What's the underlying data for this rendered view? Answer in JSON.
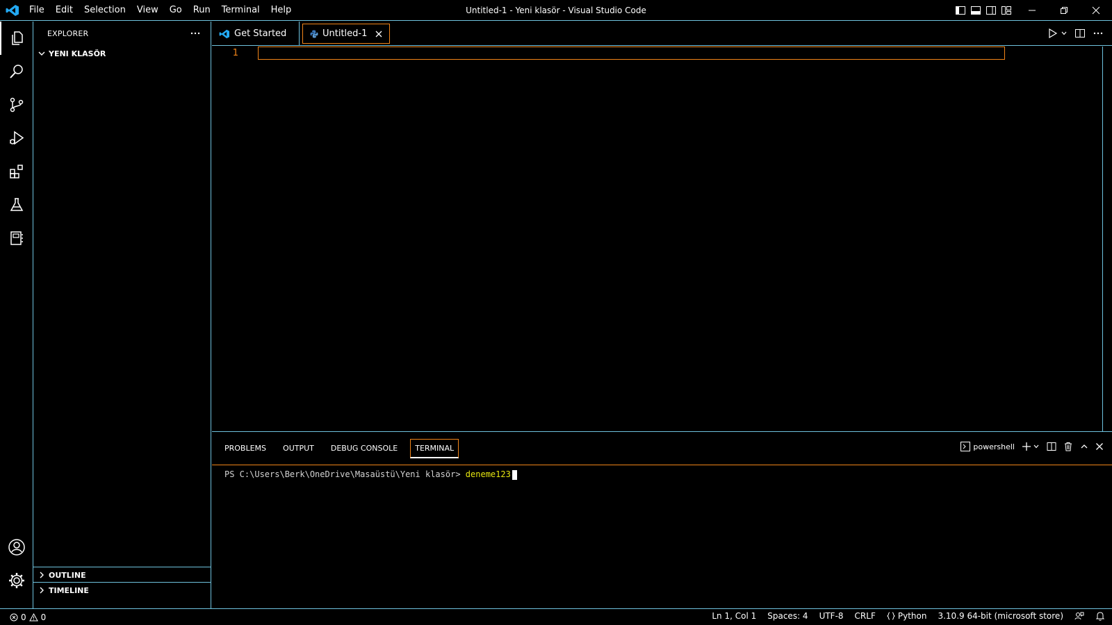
{
  "window": {
    "title": "Untitled-1 - Yeni klasör - Visual Studio Code"
  },
  "menu": [
    "File",
    "Edit",
    "Selection",
    "View",
    "Go",
    "Run",
    "Terminal",
    "Help"
  ],
  "sidebar": {
    "header": "EXPLORER",
    "folder": "YENI KLASÖR",
    "outline": "OUTLINE",
    "timeline": "TIMELINE"
  },
  "tabs": {
    "get_started": "Get Started",
    "untitled": "Untitled-1"
  },
  "editor": {
    "line_number": "1"
  },
  "panel": {
    "tabs": [
      "PROBLEMS",
      "OUTPUT",
      "DEBUG CONSOLE",
      "TERMINAL"
    ],
    "shell": "powershell",
    "prompt": "PS C:\\Users\\Berk\\OneDrive\\Masaüstü\\Yeni klasör>",
    "command": "deneme123"
  },
  "status": {
    "errors": "0",
    "warnings": "0",
    "position": "Ln 1, Col 1",
    "spaces": "Spaces: 4",
    "encoding": "UTF-8",
    "eol": "CRLF",
    "language": "Python",
    "interpreter": "3.10.9 64-bit (microsoft store)"
  },
  "colors": {
    "accent_border": "#6fc3df",
    "focus_border": "#f38518",
    "python_icon": "#3c7abe",
    "vscode_logo": "#23a9f2"
  },
  "icons": {
    "activity": [
      "explorer-icon",
      "search-icon",
      "source-control-icon",
      "run-debug-icon",
      "extensions-icon",
      "testing-icon",
      "notebook-icon",
      "account-icon",
      "settings-gear-icon"
    ]
  }
}
